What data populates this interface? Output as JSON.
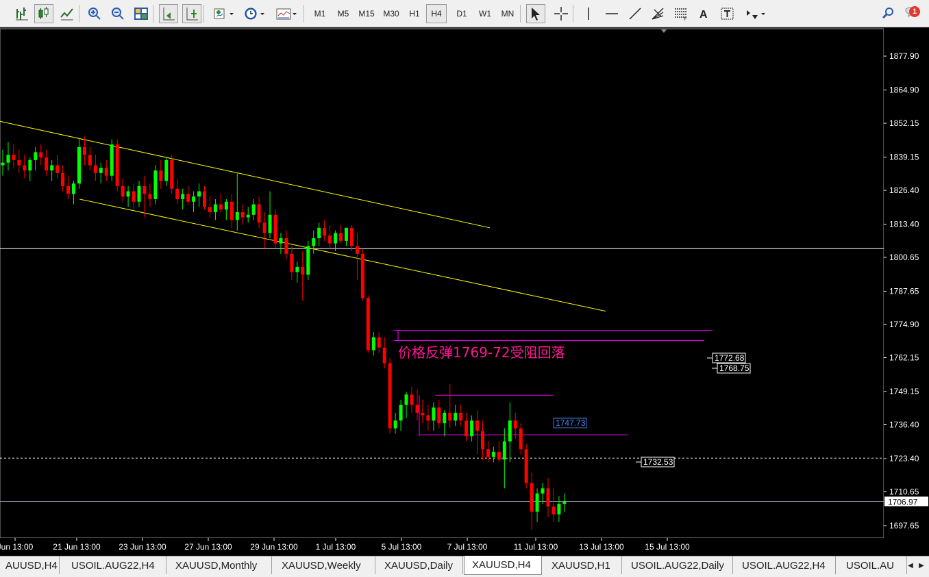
{
  "toolbar": {
    "timeframes": [
      "M1",
      "M5",
      "M15",
      "M30",
      "H1",
      "H4",
      "D1",
      "W1",
      "MN"
    ],
    "active_timeframe": "H4",
    "notification_count": "1",
    "icons": [
      "bar-chart-icon",
      "candlestick-chart-icon",
      "line-chart-icon",
      "zoom-in-icon",
      "zoom-out-icon",
      "tile-windows-icon",
      "auto-scroll-icon",
      "chart-shift-icon",
      "indicators-icon",
      "periods-clock-icon",
      "templates-icon",
      "cursor-icon",
      "crosshair-icon",
      "vertical-line-icon",
      "horizontal-line-icon",
      "trendline-icon",
      "fibonacci-fan-icon",
      "fibonacci-retracement-icon",
      "text-icon",
      "text-label-icon",
      "arrows-icon",
      "search-icon",
      "chat-icon"
    ]
  },
  "chart": {
    "symbol": "XAUUSD",
    "timeframe": "H4",
    "background": "#000000",
    "bull_color": "#00ff00",
    "bear_color": "#ff0000",
    "channel_color": "#ffff00",
    "level_color": "#ff00ff",
    "annotation": "价格反弹1769-72受阻回落",
    "annotation_color": "#ff1493",
    "price_labels": [
      {
        "value": "1772.68",
        "style": "white"
      },
      {
        "value": "1768.75",
        "style": "white"
      },
      {
        "value": "1747.73",
        "style": "blue"
      },
      {
        "value": "1732.53",
        "style": "white"
      }
    ],
    "current_price": "1706.97"
  },
  "chart_data": {
    "type": "candlestick",
    "symbol": "XAUUSD",
    "timeframe": "H4",
    "y_ticks": [
      "1877.90",
      "1864.90",
      "1852.15",
      "1839.15",
      "1826.40",
      "1813.40",
      "1800.65",
      "1787.65",
      "1774.90",
      "1762.15",
      "1749.15",
      "1736.40",
      "1723.40",
      "1710.65",
      "1697.65"
    ],
    "x_ticks": [
      "Jun 13:00",
      "21 Jun 13:00",
      "23 Jun 13:00",
      "27 Jun 13:00",
      "29 Jun 13:00",
      "1 Jul 13:00",
      "5 Jul 13:00",
      "7 Jul 13:00",
      "11 Jul 13:00",
      "13 Jul 13:00",
      "15 Jul 13:00"
    ],
    "ylim": [
      1693,
      1884
    ],
    "horizontal_lines": [
      {
        "price": 1804.0,
        "style": "solid",
        "color": "#ffffff"
      },
      {
        "price": 1723.6,
        "style": "dashed",
        "color": "#ffffff"
      },
      {
        "price": 1706.97,
        "style": "solid",
        "color": "#8ca0b8"
      }
    ],
    "levels": [
      1772.68,
      1768.75,
      1747.73,
      1732.53
    ],
    "channel": [
      {
        "from": [
          "18 Jun 05:00",
          1853
        ],
        "to": [
          "5 Jul 13:00",
          1812
        ]
      },
      {
        "from": [
          "20 Jun 13:00",
          1823
        ],
        "to": [
          "7 Jul 17:00",
          1780
        ]
      }
    ],
    "candles": [
      [
        1836,
        1842,
        1832,
        1837
      ],
      [
        1837,
        1845,
        1834,
        1840
      ],
      [
        1840,
        1844,
        1835,
        1838
      ],
      [
        1838,
        1842,
        1833,
        1836
      ],
      [
        1836,
        1840,
        1831,
        1834
      ],
      [
        1834,
        1839,
        1830,
        1838
      ],
      [
        1838,
        1843,
        1834,
        1841
      ],
      [
        1841,
        1844,
        1836,
        1839
      ],
      [
        1839,
        1842,
        1832,
        1834
      ],
      [
        1834,
        1838,
        1830,
        1836
      ],
      [
        1836,
        1840,
        1831,
        1833
      ],
      [
        1833,
        1836,
        1826,
        1828
      ],
      [
        1828,
        1832,
        1823,
        1825
      ],
      [
        1825,
        1830,
        1821,
        1829
      ],
      [
        1829,
        1846,
        1827,
        1843
      ],
      [
        1843,
        1847,
        1836,
        1840
      ],
      [
        1840,
        1843,
        1834,
        1836
      ],
      [
        1836,
        1840,
        1830,
        1833
      ],
      [
        1833,
        1837,
        1829,
        1835
      ],
      [
        1835,
        1838,
        1830,
        1832
      ],
      [
        1832,
        1846,
        1830,
        1844
      ],
      [
        1844,
        1846,
        1826,
        1828
      ],
      [
        1828,
        1831,
        1822,
        1824
      ],
      [
        1824,
        1828,
        1820,
        1826
      ],
      [
        1826,
        1829,
        1819,
        1822
      ],
      [
        1822,
        1830,
        1820,
        1828
      ],
      [
        1828,
        1832,
        1816,
        1825
      ],
      [
        1825,
        1829,
        1820,
        1823
      ],
      [
        1823,
        1836,
        1821,
        1834
      ],
      [
        1834,
        1838,
        1827,
        1830
      ],
      [
        1830,
        1839,
        1828,
        1838
      ],
      [
        1838,
        1840,
        1825,
        1827
      ],
      [
        1827,
        1831,
        1821,
        1823
      ],
      [
        1823,
        1827,
        1819,
        1825
      ],
      [
        1825,
        1828,
        1821,
        1822
      ],
      [
        1822,
        1826,
        1818,
        1824
      ],
      [
        1824,
        1829,
        1820,
        1826
      ],
      [
        1826,
        1828,
        1819,
        1820
      ],
      [
        1820,
        1824,
        1816,
        1818
      ],
      [
        1818,
        1823,
        1815,
        1821
      ],
      [
        1821,
        1825,
        1818,
        1819
      ],
      [
        1819,
        1823,
        1815,
        1822
      ],
      [
        1822,
        1825,
        1812,
        1815
      ],
      [
        1815,
        1833,
        1811,
        1818
      ],
      [
        1818,
        1821,
        1813,
        1816
      ],
      [
        1816,
        1820,
        1814,
        1817
      ],
      [
        1817,
        1823,
        1815,
        1821
      ],
      [
        1821,
        1824,
        1812,
        1814
      ],
      [
        1814,
        1818,
        1804,
        1810
      ],
      [
        1810,
        1826,
        1808,
        1817
      ],
      [
        1817,
        1819,
        1804,
        1806
      ],
      [
        1806,
        1810,
        1802,
        1808
      ],
      [
        1808,
        1811,
        1800,
        1802
      ],
      [
        1802,
        1805,
        1792,
        1795
      ],
      [
        1795,
        1799,
        1791,
        1797
      ],
      [
        1797,
        1803,
        1784,
        1794
      ],
      [
        1794,
        1807,
        1792,
        1805
      ],
      [
        1805,
        1811,
        1802,
        1808
      ],
      [
        1808,
        1814,
        1805,
        1812
      ],
      [
        1812,
        1815,
        1807,
        1809
      ],
      [
        1809,
        1813,
        1804,
        1806
      ],
      [
        1806,
        1811,
        1803,
        1810
      ],
      [
        1810,
        1813,
        1806,
        1807
      ],
      [
        1807,
        1812,
        1805,
        1812
      ],
      [
        1812,
        1813,
        1803,
        1805
      ],
      [
        1805,
        1810,
        1792,
        1802
      ],
      [
        1802,
        1804,
        1784,
        1785
      ],
      [
        1785,
        1786,
        1764,
        1765
      ],
      [
        1765,
        1772,
        1763,
        1770
      ],
      [
        1770,
        1772,
        1764,
        1766
      ],
      [
        1766,
        1770,
        1758,
        1760
      ],
      [
        1760,
        1762,
        1733,
        1735
      ],
      [
        1735,
        1741,
        1733,
        1738
      ],
      [
        1738,
        1746,
        1734,
        1744
      ],
      [
        1744,
        1749,
        1739,
        1748
      ],
      [
        1748,
        1751,
        1741,
        1744
      ],
      [
        1744,
        1750,
        1738,
        1741
      ],
      [
        1741,
        1746,
        1737,
        1740
      ],
      [
        1740,
        1744,
        1734,
        1738
      ],
      [
        1738,
        1745,
        1734,
        1743
      ],
      [
        1743,
        1746,
        1735,
        1737
      ],
      [
        1737,
        1742,
        1732,
        1741
      ],
      [
        1741,
        1752,
        1735,
        1738
      ],
      [
        1738,
        1744,
        1736,
        1741
      ],
      [
        1741,
        1744,
        1736,
        1738
      ],
      [
        1738,
        1741,
        1730,
        1732
      ],
      [
        1732,
        1740,
        1730,
        1738
      ],
      [
        1738,
        1742,
        1725,
        1734
      ],
      [
        1734,
        1738,
        1723,
        1727
      ],
      [
        1727,
        1730,
        1722,
        1724
      ],
      [
        1724,
        1728,
        1722,
        1726
      ],
      [
        1726,
        1730,
        1722,
        1723
      ],
      [
        1723,
        1735,
        1712,
        1730
      ],
      [
        1730,
        1745,
        1722,
        1738
      ],
      [
        1738,
        1741,
        1731,
        1735
      ],
      [
        1735,
        1737,
        1725,
        1727
      ],
      [
        1727,
        1729,
        1712,
        1714
      ],
      [
        1714,
        1718,
        1696,
        1703
      ],
      [
        1703,
        1712,
        1699,
        1710
      ],
      [
        1710,
        1714,
        1706,
        1712
      ],
      [
        1712,
        1716,
        1701,
        1705
      ],
      [
        1705,
        1712,
        1699,
        1702
      ],
      [
        1702,
        1709,
        1699,
        1706
      ],
      [
        1706,
        1710,
        1703,
        1707
      ]
    ]
  }
}
